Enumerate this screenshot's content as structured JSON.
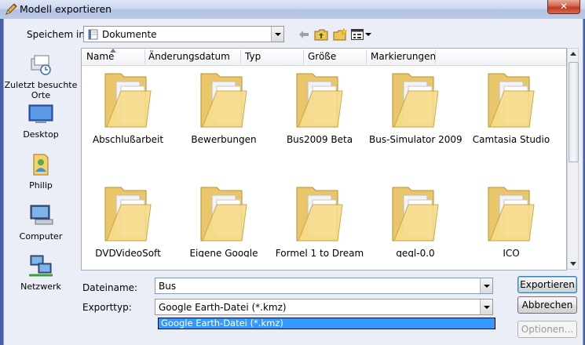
{
  "window": {
    "title": "Modell exportieren",
    "close_label": "✕"
  },
  "save_in": {
    "label": "Speichem in:",
    "value": "Dokumente"
  },
  "columns": [
    "Name",
    "Änderungsdatum",
    "Typ",
    "Größe",
    "Markierungen"
  ],
  "places": [
    {
      "label": "Zuletzt besuchte Orte",
      "icon": "recent-places-icon"
    },
    {
      "label": "Desktop",
      "icon": "desktop-icon"
    },
    {
      "label": "Philip",
      "icon": "user-folder-icon"
    },
    {
      "label": "Computer",
      "icon": "computer-icon"
    },
    {
      "label": "Netzwerk",
      "icon": "network-icon"
    }
  ],
  "folders_row1": [
    "Abschlußarbeit",
    "Bewerbungen",
    "Bus2009 Beta",
    "Bus-Simulator 2009",
    "Camtasia Studio"
  ],
  "folders_row2": [
    "DVDVideoSoft",
    "Eigene Google",
    "Formel 1 to Dream",
    "gegl-0.0",
    "ICO"
  ],
  "filename": {
    "label": "Dateiname:",
    "value": "Bus"
  },
  "exporttype": {
    "label": "Exporttyp:",
    "value": "Google Earth-Datei (*.kmz)",
    "options": [
      "Google Earth-Datei (*.kmz)"
    ]
  },
  "buttons": {
    "export": "Exportieren",
    "cancel": "Abbrechen",
    "options": "Optionen..."
  }
}
